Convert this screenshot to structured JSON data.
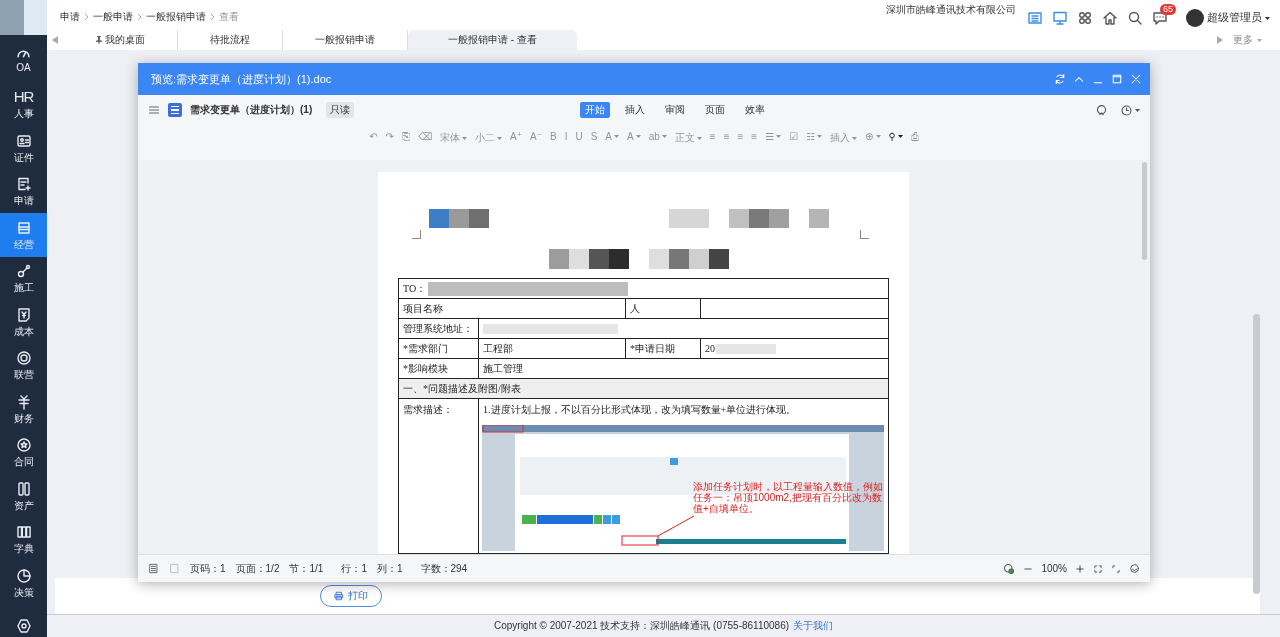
{
  "breadcrumb": [
    {
      "label": "申请",
      "current": false
    },
    {
      "label": "一般申请",
      "current": false
    },
    {
      "label": "一般报销申请",
      "current": false
    },
    {
      "label": "查看",
      "current": true
    }
  ],
  "company": "深圳市皓峰通讯技术有限公司",
  "header_icons": [
    {
      "kind": "list"
    },
    {
      "kind": "monitor"
    },
    {
      "kind": "apps"
    },
    {
      "kind": "home"
    },
    {
      "kind": "search"
    },
    {
      "kind": "chat",
      "badge": "65"
    }
  ],
  "user": {
    "name": "超级管理员"
  },
  "tabs": [
    {
      "label": "我的桌面",
      "pinned": true,
      "selected": false
    },
    {
      "label": "待批流程",
      "pinned": false,
      "selected": false
    },
    {
      "label": "一般报销申请",
      "pinned": false,
      "selected": false
    },
    {
      "label": "一般报销申请 - 查看",
      "pinned": false,
      "selected": true
    }
  ],
  "more": "更多",
  "sidebar": [
    {
      "kind": "gauge",
      "label": "OA",
      "selected": false
    },
    {
      "kind": "hr",
      "icon_text": "HR",
      "label": "人事",
      "selected": false
    },
    {
      "kind": "card",
      "label": "证件",
      "selected": false
    },
    {
      "kind": "doc",
      "label": "申请",
      "selected": false
    },
    {
      "kind": "store",
      "label": "经营",
      "selected": true
    },
    {
      "kind": "tool",
      "label": "施工",
      "selected": false
    },
    {
      "kind": "yen",
      "label": "成本",
      "selected": false
    },
    {
      "kind": "ring",
      "label": "联营",
      "selected": false
    },
    {
      "kind": "currency",
      "label": "财务",
      "selected": false
    },
    {
      "kind": "star",
      "label": "合同",
      "selected": false
    },
    {
      "kind": "asset",
      "label": "资产",
      "selected": false
    },
    {
      "kind": "books",
      "label": "字典",
      "selected": false
    },
    {
      "kind": "pie",
      "label": "决策",
      "selected": false
    },
    {
      "kind": "settings",
      "selected": false
    }
  ],
  "preview": {
    "title": "预览:需求变更单（进度计划）(1).doc",
    "doc_name": "需求变更单（进度计划）(1)",
    "readonly": "只读",
    "ribbon_tabs": [
      {
        "label": "开始",
        "selected": true
      },
      {
        "label": "插入",
        "selected": false
      },
      {
        "label": "审阅",
        "selected": false
      },
      {
        "label": "页面",
        "selected": false
      },
      {
        "label": "效率",
        "selected": false
      }
    ],
    "tools": [
      {
        "text": "↶",
        "dropdown": false,
        "disabled": true
      },
      {
        "text": "↷",
        "dropdown": false,
        "disabled": true
      },
      {
        "text": "⎘",
        "dropdown": false,
        "disabled": true
      },
      {
        "text": "⌫",
        "dropdown": false,
        "disabled": true
      },
      {
        "text": "宋体",
        "dropdown": true,
        "disabled": true
      },
      {
        "text": "小二",
        "dropdown": true,
        "disabled": true
      },
      {
        "text": "A⁺",
        "dropdown": false,
        "disabled": true
      },
      {
        "text": "A⁻",
        "dropdown": false,
        "disabled": true
      },
      {
        "text": "B",
        "dropdown": false,
        "disabled": true
      },
      {
        "text": "I",
        "dropdown": false,
        "disabled": true
      },
      {
        "text": "U",
        "dropdown": false,
        "disabled": true
      },
      {
        "text": "S",
        "dropdown": false,
        "disabled": true
      },
      {
        "text": "A",
        "dropdown": true,
        "disabled": true
      },
      {
        "text": "A",
        "dropdown": true,
        "disabled": true
      },
      {
        "text": "ab",
        "dropdown": true,
        "disabled": true
      },
      {
        "text": "正文",
        "dropdown": true,
        "disabled": true
      },
      {
        "text": "≡",
        "dropdown": false,
        "disabled": true
      },
      {
        "text": "≡",
        "dropdown": false,
        "disabled": true
      },
      {
        "text": "≡",
        "dropdown": false,
        "disabled": true
      },
      {
        "text": "≡",
        "dropdown": false,
        "disabled": true
      },
      {
        "text": "☰",
        "dropdown": true,
        "disabled": true
      },
      {
        "text": "☑",
        "dropdown": false,
        "disabled": true
      },
      {
        "text": "☷",
        "dropdown": true,
        "disabled": true
      },
      {
        "text": "插入",
        "dropdown": true,
        "disabled": true
      },
      {
        "text": "⊕",
        "dropdown": true,
        "disabled": true
      },
      {
        "text": "⚲",
        "dropdown": true,
        "disabled": false
      },
      {
        "text": "⎙",
        "dropdown": false,
        "disabled": true
      }
    ],
    "table": [
      {
        "kind": "full",
        "cells": [
          "TO："
        ]
      },
      {
        "kind": "wide_label",
        "cells": [
          "项目名称",
          "人"
        ]
      },
      {
        "kind": "label_value",
        "cells": [
          "管理系统地址："
        ]
      },
      {
        "kind": "four",
        "cells": [
          "*需求部门",
          "工程部",
          "*申请日期",
          "20"
        ]
      },
      {
        "kind": "label_value",
        "cells": [
          "*影响模块",
          "施工管理"
        ]
      },
      {
        "kind": "section",
        "cells": [
          "一、*问题描述及附图/附表"
        ]
      },
      {
        "kind": "description",
        "cells": [
          "需求描述：",
          "1.进度计划上报，不以百分比形式体现，改为填写数量+单位进行体现。"
        ]
      }
    ],
    "annotation": "添加任务计划时，以工程量输入数值，例如任务一：吊顶1000m2,把现有百分比改为数值+自填单位。",
    "status": [
      "页码：1",
      "页面：1/2",
      "节：1/1",
      "行：1",
      "列：1",
      "字数：294"
    ],
    "zoom": "100%"
  },
  "print": "打印",
  "footer": {
    "text": "Copyright © 2007-2021 技术支持：深圳皓峰通讯 (0755-86110086)",
    "link": "关于我们"
  }
}
